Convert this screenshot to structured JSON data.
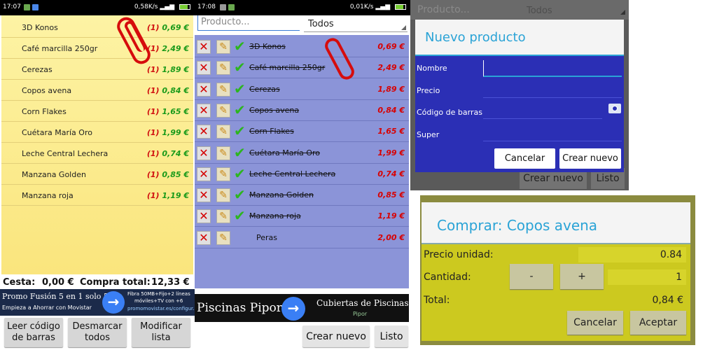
{
  "panel1": {
    "status": {
      "time": "17:07",
      "speed": "0,58K/s"
    },
    "items": [
      {
        "name": "3D Konos",
        "qty": "(1)",
        "price": "0,69 €"
      },
      {
        "name": "Café marcilla 250gr",
        "qty": "(1)",
        "price": "2,49 €"
      },
      {
        "name": "Cerezas",
        "qty": "(1)",
        "price": "1,89 €"
      },
      {
        "name": "Copos avena",
        "qty": "(1)",
        "price": "0,84 €"
      },
      {
        "name": "Corn Flakes",
        "qty": "(1)",
        "price": "1,65 €"
      },
      {
        "name": "Cuétara María Oro",
        "qty": "(1)",
        "price": "1,99 €"
      },
      {
        "name": "Leche Central Lechera",
        "qty": "(1)",
        "price": "0,74 €"
      },
      {
        "name": "Manzana Golden",
        "qty": "(1)",
        "price": "0,85 €"
      },
      {
        "name": "Manzana roja",
        "qty": "(1)",
        "price": "1,19 €"
      }
    ],
    "totals": {
      "cesta_label": "Cesta:",
      "cesta_value": "0,00 €",
      "compra_label": "Compra total:",
      "compra_value": "12,33 €"
    },
    "ad": {
      "headline": "Promo Fusión 5 en 1 solo 55€",
      "sub": "Empieza a Ahorrar con Movistar",
      "right1": "Fibra 50MB+Fijo+2 líneas",
      "right2": "móviles+TV con +6",
      "right3": "promomovistar.es/configur..."
    },
    "buttons": {
      "scan": "Leer código de barras",
      "unmark": "Desmarcar todos",
      "modify": "Modificar lista"
    }
  },
  "panel2": {
    "status": {
      "time": "17:08",
      "speed": "0,01K/s"
    },
    "search_placeholder": "Producto...",
    "filter_value": "Todos",
    "items": [
      {
        "name": "3D Konos",
        "price": "0,69 €",
        "checked": true
      },
      {
        "name": "Café marcilla 250gr",
        "price": "2,49 €",
        "checked": true
      },
      {
        "name": "Cerezas",
        "price": "1,89 €",
        "checked": true
      },
      {
        "name": "Copos avena",
        "price": "0,84 €",
        "checked": true
      },
      {
        "name": "Corn Flakes",
        "price": "1,65 €",
        "checked": true
      },
      {
        "name": "Cuétara María Oro",
        "price": "1,99 €",
        "checked": true
      },
      {
        "name": "Leche Central Lechera",
        "price": "0,74 €",
        "checked": true
      },
      {
        "name": "Manzana Golden",
        "price": "0,85 €",
        "checked": true
      },
      {
        "name": "Manzana roja",
        "price": "1,19 €",
        "checked": true
      },
      {
        "name": "Peras",
        "price": "2,00 €",
        "checked": false
      }
    ],
    "ad": {
      "headline": "Piscinas Pipor",
      "right1": "Cubiertas de Piscinas",
      "right2": "Pipor"
    },
    "buttons": {
      "create": "Crear nuevo",
      "done": "Listo"
    }
  },
  "panel3": {
    "bg_search": "Producto...",
    "bg_filter": "Todos",
    "bg_create": "Crear nuevo",
    "bg_done": "Listo",
    "dialog_title": "Nuevo producto",
    "fields": {
      "name": "Nombre",
      "price": "Precio",
      "barcode": "Código de barras",
      "store": "Super"
    },
    "cancel": "Cancelar",
    "create": "Crear nuevo"
  },
  "panel4": {
    "dialog_title": "Comprar: Copos avena",
    "unit_price_label": "Precio unidad:",
    "unit_price_value": "0.84",
    "qty_label": "Cantidad:",
    "minus": "-",
    "plus": "+",
    "qty_value": "1",
    "total_label": "Total:",
    "total_value": "0,84 €",
    "cancel": "Cancelar",
    "accept": "Aceptar"
  },
  "colors": {
    "note_yellow": "#fae57d",
    "list_blue": "#8b94d8",
    "dialog_blue": "#2b2fb5",
    "dialog_yellow": "#ccc91f",
    "title_cyan": "#2aa3d6",
    "price_green": "#1a9a1a",
    "price_red": "#d80000"
  }
}
